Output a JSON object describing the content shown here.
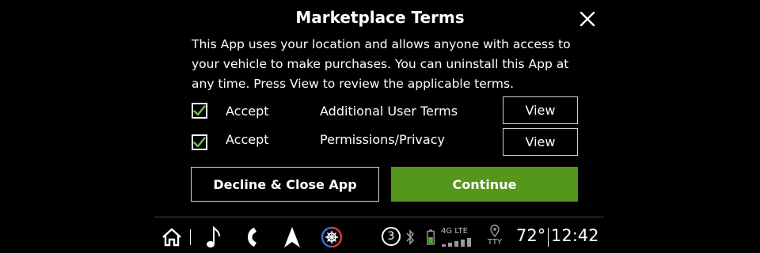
{
  "dialog": {
    "title": "Marketplace Terms",
    "message": "This App uses your location and allows anyone with access to your vehicle to make purchases. You can uninstall this App at any time. Press View to review the applicable terms.",
    "terms": [
      {
        "accept_label": "Accept",
        "name": "Additional User Terms",
        "checked": true,
        "view_label": "View"
      },
      {
        "accept_label": "Accept",
        "name": "Permissions/Privacy",
        "checked": true,
        "view_label": "View"
      }
    ],
    "decline_label": "Decline & Close App",
    "continue_label": "Continue"
  },
  "colors": {
    "background": "#000000",
    "continue_green": "#55971b",
    "check_green": "#6cc04a",
    "divider_blue": "#2d4e7a",
    "climate_red": "#d23a2a",
    "climate_blue": "#2f6fd6"
  },
  "status_bar": {
    "icons": [
      "home-icon",
      "music-note-icon",
      "phone-icon",
      "navigation-arrow-icon",
      "climate-icon"
    ],
    "notification_count": "3",
    "network": "4G LTE",
    "tty_label": "TTY",
    "temperature": "72°",
    "time": "12:42"
  }
}
